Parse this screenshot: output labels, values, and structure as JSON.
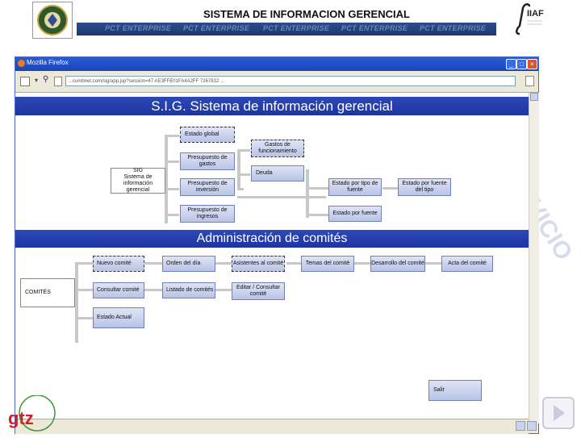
{
  "slide": {
    "title": "SISTEMA DE INFORMACION GERENCIAL",
    "band_items": [
      "PCT ENTERPRISE",
      "PCT ENTERPRISE",
      "PCT ENTERPRISE",
      "PCT ENTERPRISE",
      "PCT ENTERPRISE"
    ],
    "right_logo_text": "IIAF",
    "watermark": "SERVICIO",
    "bottom_logo_text": "gtz"
  },
  "browser": {
    "title": "Mozilla Firefox",
    "url": "...cumbnet.com/sig/app.jsp?session=47 AE3FFE01FA4A2FF 7267832 ...",
    "controls": {
      "minimize": "_",
      "maximize": "□",
      "close": "×"
    }
  },
  "sig": {
    "banner": "S.I.G. Sistema de información gerencial",
    "root": "SIG\nSistema de\ninformación gerencial",
    "estado_global": "Estado global",
    "presupuesto_gastos": "Presupuesto de gastos",
    "presupuesto_inversion": "Presupuesto de inversión",
    "presupuesto_ingresos": "Presupuesto de ingresos",
    "gastos_funcionamiento": "Gastos de funcionamiento",
    "deuda": "Deuda",
    "estado_tipo_fuente": "Estado por tipo de fuente",
    "estado_fuente_tipo": "Estado por fuente del tipo",
    "estado_fuente": "Estado por fuente"
  },
  "comites": {
    "banner": "Administración de comités",
    "root": "COMITÉS",
    "nuevo": "Nuevo comité",
    "consultar": "Consultar comité",
    "estado_actual": "Estado Actual",
    "orden_dia": "Orden del día",
    "listado": "Listado de comités",
    "asistentes": "Asistentes al comité",
    "editar": "Editar / Consultar comité",
    "temas": "Temas del comité",
    "desarrollo": "Desarrollo del comité",
    "acta": "Acta del comité",
    "salir": "Salir"
  }
}
